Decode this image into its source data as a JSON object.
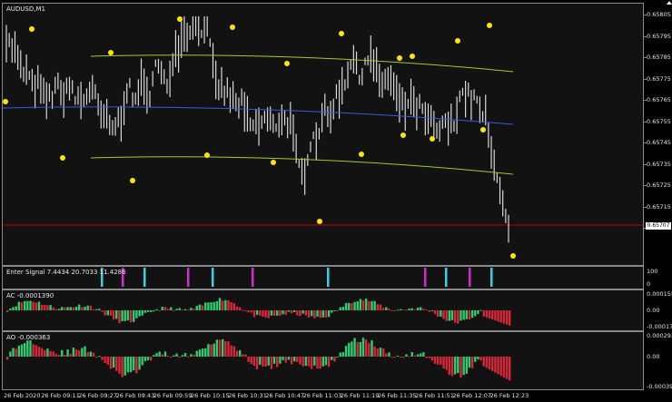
{
  "main": {
    "title": "AUDUSD,M1",
    "price_scale": [
      "0.65805",
      "0.65795",
      "0.65785",
      "0.65775",
      "0.65765",
      "0.65755",
      "0.65745",
      "0.65735",
      "0.65725",
      "0.65715",
      "0.65705"
    ],
    "current_price": "0.65707",
    "colors": {
      "background": "#121212",
      "bars": "#d9d9d9",
      "upper_band": "#9acd32",
      "mid_band": "#3b5bdb",
      "lower_band": "#9acd32",
      "fractals": "#ffe600",
      "price_line": "#cc0000"
    }
  },
  "enter_signal": {
    "label": "Enter Signal 7.4434 20.7033 11.4286",
    "scale": [
      "100",
      "0"
    ],
    "colors": {
      "cyan": "#39d0e6",
      "magenta": "#d22ad2"
    },
    "signals": [
      "cyan",
      "magenta",
      "cyan",
      "magenta",
      "cyan",
      "magenta",
      "cyan",
      "magenta",
      "cyan",
      "magenta",
      "cyan"
    ]
  },
  "ac": {
    "label": "AC -0.0001390",
    "scale": [
      "0.000155",
      "0.00",
      "-0.000172"
    ],
    "colors": {
      "up": "#2ecc71",
      "down": "#d62839"
    }
  },
  "ao": {
    "label": "AO -0.000363",
    "scale": [
      "0.000293",
      "0.00",
      "-0.000394"
    ],
    "colors": {
      "up": "#2ecc71",
      "down": "#d62839"
    }
  },
  "time_axis": [
    "26 Feb 2020",
    "26 Feb 09:11",
    "26 Feb 09:27",
    "26 Feb 09:43",
    "26 Feb 09:59",
    "26 Feb 10:15",
    "26 Feb 10:31",
    "26 Feb 10:47",
    "26 Feb 11:03",
    "26 Feb 11:19",
    "26 Feb 11:35",
    "26 Feb 11:51",
    "26 Feb 12:07",
    "26 Feb 12:23"
  ]
}
